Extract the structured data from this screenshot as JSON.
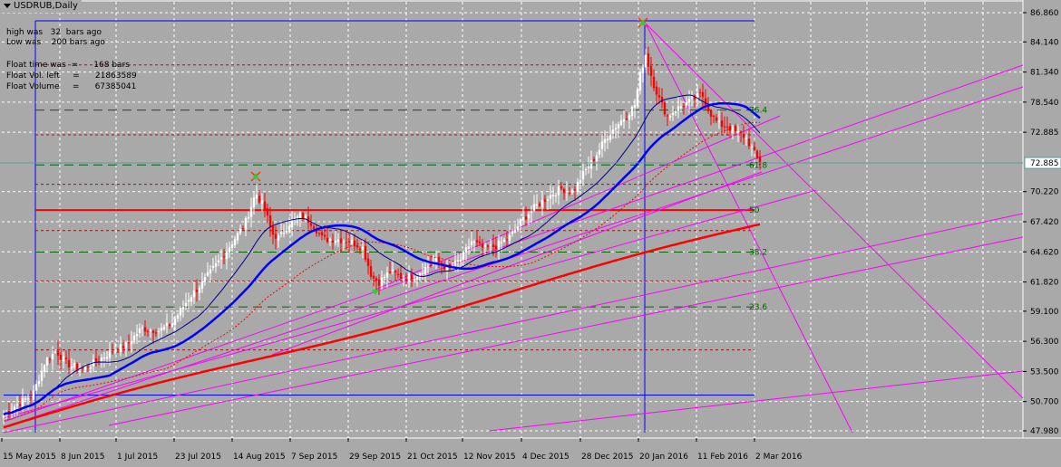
{
  "symbol": "USDRUB,Daily",
  "info": {
    "high_was": "high was   32  bars ago",
    "low_was": "Low was    200 bars ago",
    "float_time": "Float time was  =      168 bars",
    "float_vol": "Float Vol. left     =      21863589",
    "float_volume": "Float Volume     =      67385041"
  },
  "colors": {
    "background": "#a9a9a9",
    "bull_candle": "#ffffff",
    "bear_candle": "#ff0000",
    "ma_thin": "#00008b",
    "ma_blue": "#0000ff",
    "ma_red": "#ff0000",
    "fibo_green": "#006400",
    "fibo_red_dashed": "#cc0000",
    "magenta": "#ff00ff",
    "grid": "#ffffff",
    "price_line": "#5f9ea0"
  },
  "chart_data": {
    "type": "candlestick",
    "instrument": "USDRUB",
    "timeframe": "Daily",
    "x_tick_labels": [
      "15 May 2015",
      "8 Jun 2015",
      "1 Jul 2015",
      "23 Jul 2015",
      "14 Aug 2015",
      "7 Sep 2015",
      "29 Sep 2015",
      "21 Oct 2015",
      "12 Nov 2015",
      "4 Dec 2015",
      "28 Dec 2015",
      "20 Jan 2016",
      "11 Feb 2016",
      "2 Mar 2016"
    ],
    "y_tick_labels": [
      "86.860",
      "84.140",
      "81.340",
      "78.540",
      "75.740",
      "72.885",
      "70.220",
      "67.420",
      "64.620",
      "61.820",
      "59.100",
      "56.300",
      "53.500",
      "50.700",
      "47.980"
    ],
    "y_ticks": [
      86.86,
      84.14,
      81.34,
      78.54,
      75.74,
      70.22,
      67.42,
      64.62,
      61.82,
      59.1,
      56.3,
      53.5,
      50.7,
      47.98
    ],
    "ylim": [
      47.7,
      87.7
    ],
    "current_price": 72.885,
    "current_price_label": "72.885",
    "fibo_levels": [
      {
        "label": "76.4",
        "price": 77.8
      },
      {
        "label": "61.8",
        "price": 72.7
      },
      {
        "label": "50",
        "price": 68.5
      },
      {
        "label": "38.2",
        "price": 64.6
      },
      {
        "label": "23.6",
        "price": 59.5
      }
    ],
    "red_dashed_levels": [
      82.0,
      75.5,
      70.9,
      66.6,
      61.9,
      55.5
    ],
    "channel_top_price": 86.1,
    "channel_bottom_price": 51.3,
    "pivot_high": 86.1,
    "pivot_low": 48.7,
    "grid": true
  }
}
